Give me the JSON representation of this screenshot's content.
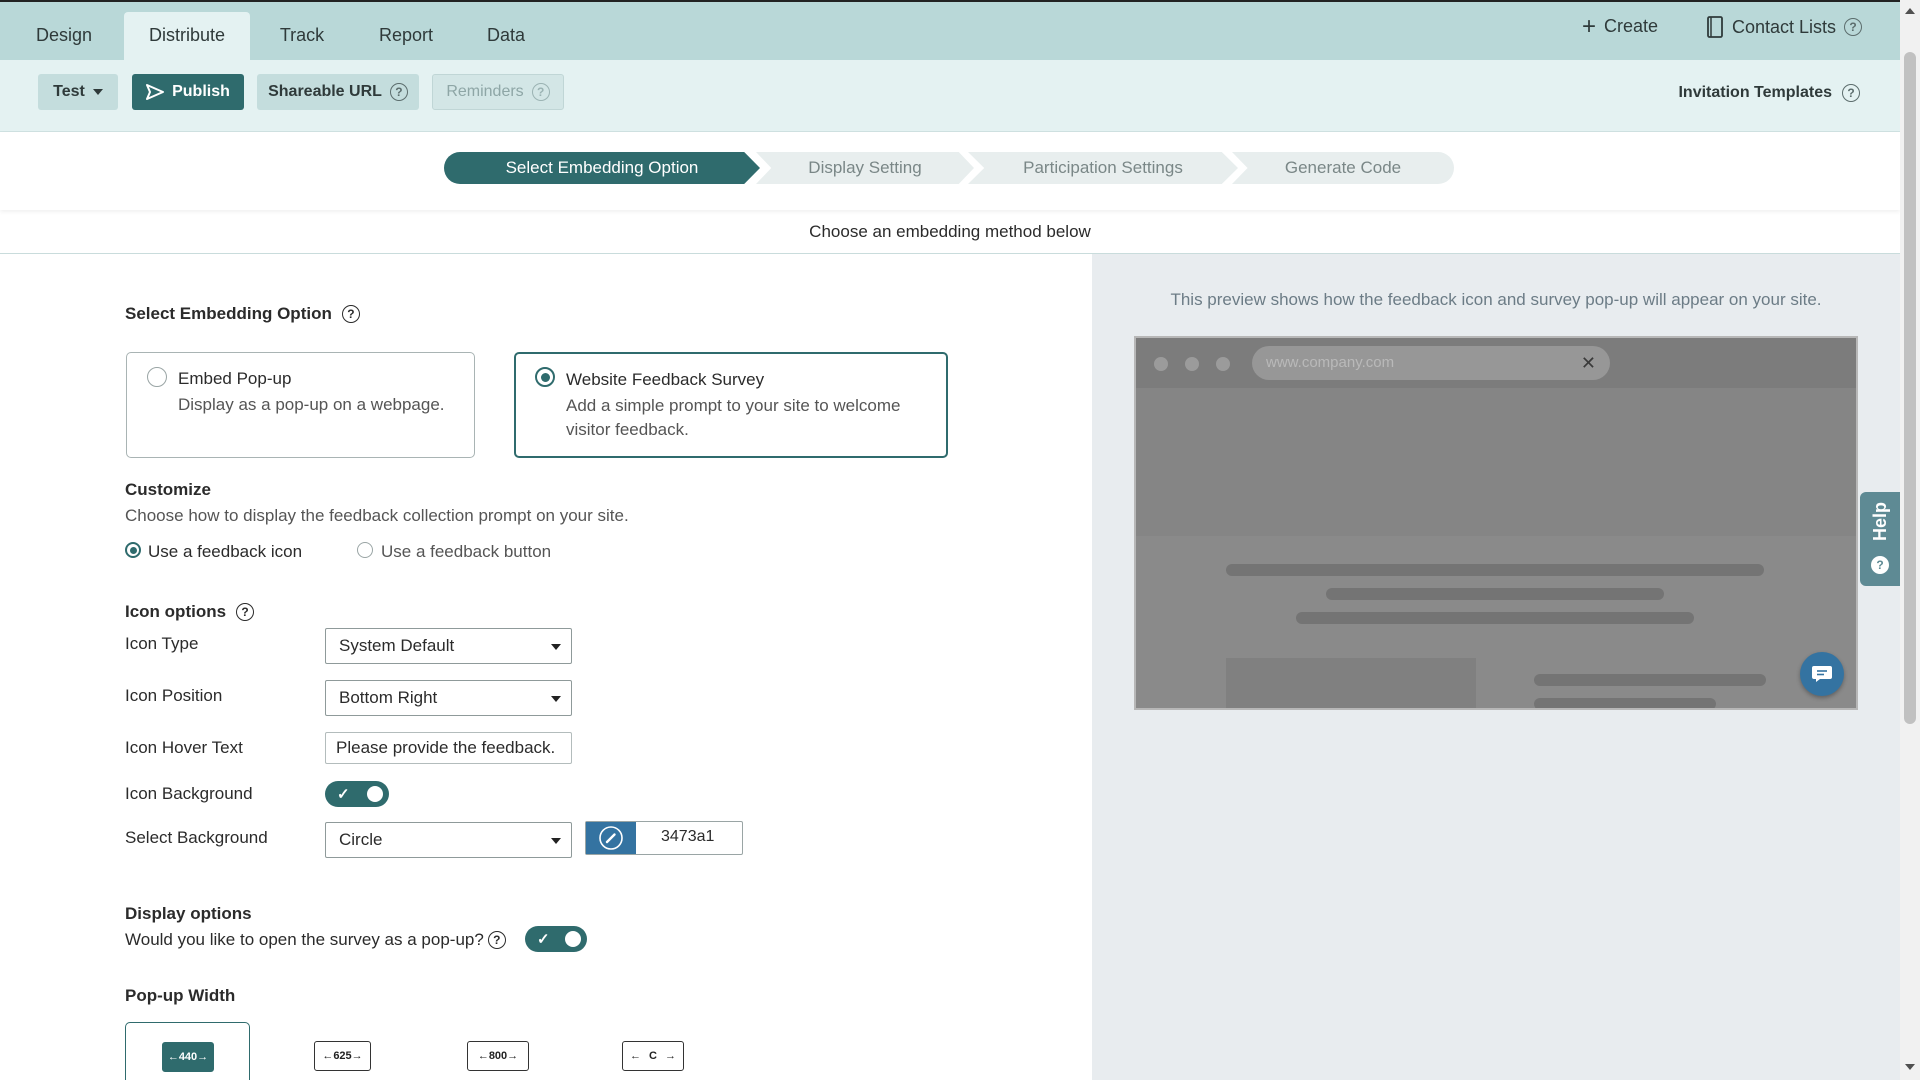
{
  "tabs": [
    {
      "label": "Design"
    },
    {
      "label": "Distribute",
      "active": true
    },
    {
      "label": "Track"
    },
    {
      "label": "Report"
    },
    {
      "label": "Data"
    }
  ],
  "top_right": {
    "create": "Create",
    "contact_lists": "Contact Lists"
  },
  "toolbar": {
    "test": "Test",
    "publish": "Publish",
    "shareable_url": "Shareable URL",
    "reminders": "Reminders",
    "invitation_templates": "Invitation Templates"
  },
  "steps": [
    {
      "label": "Select Embedding Option",
      "active": true
    },
    {
      "label": "Display Setting"
    },
    {
      "label": "Participation Settings"
    },
    {
      "label": "Generate Code"
    }
  ],
  "subheader": "Choose an embedding method below",
  "embedding": {
    "title": "Select Embedding Option",
    "options": [
      {
        "title": "Embed Pop-up",
        "desc": "Display as a pop-up on a webpage.",
        "selected": false
      },
      {
        "title": "Website Feedback Survey",
        "desc_line1": "Add a simple prompt to your site to welcome",
        "desc_line2": "visitor feedback.",
        "selected": true
      }
    ]
  },
  "customize": {
    "title": "Customize",
    "desc": "Choose how to display the feedback collection prompt on your site.",
    "choice_icon": "Use a feedback icon",
    "choice_button": "Use a feedback button",
    "selected": "icon"
  },
  "icon_options": {
    "title": "Icon options",
    "type_label": "Icon Type",
    "type_value": "System Default",
    "position_label": "Icon Position",
    "position_value": "Bottom Right",
    "hover_label": "Icon Hover Text",
    "hover_value": "Please provide the feedback.",
    "background_label": "Icon Background",
    "background_on": true,
    "select_bg_label": "Select Background",
    "select_bg_value": "Circle",
    "color_hex": "3473a1",
    "swatch_color": "#3473a1"
  },
  "display_options": {
    "title": "Display options",
    "question": "Would you like to open the survey as a pop-up?",
    "popup_on": true
  },
  "popup_width": {
    "title": "Pop-up Width",
    "options": [
      "440",
      "625",
      "800",
      "C"
    ],
    "selected": "440"
  },
  "preview": {
    "caption": "This preview shows how the feedback icon and survey pop-up will appear on your site.",
    "url": "www.company.com"
  },
  "help_tab": "Help",
  "colors": {
    "accent": "#2f6b6d",
    "nav_bg": "#b9d8d8",
    "toolbar_bg": "#e4f2f2",
    "icon_blue": "#3473a1"
  }
}
